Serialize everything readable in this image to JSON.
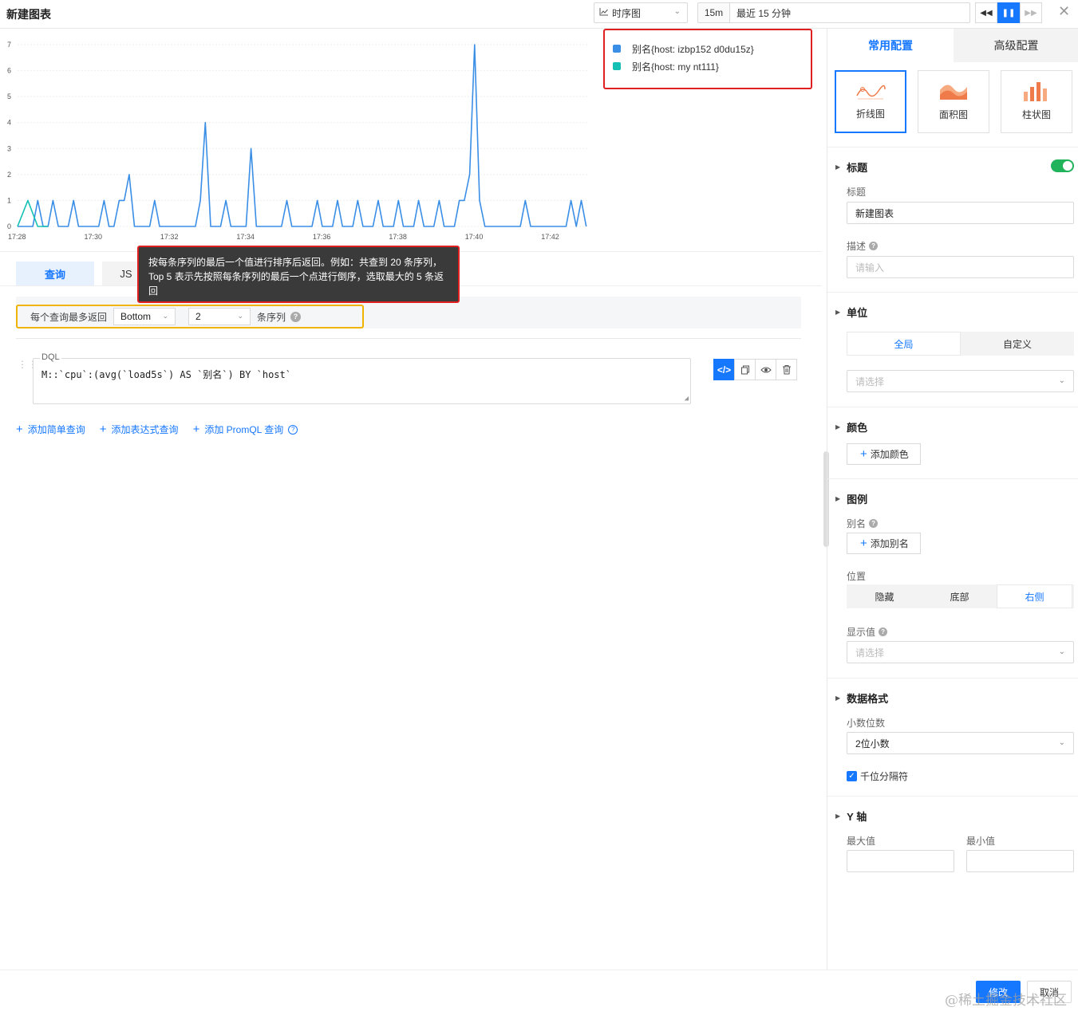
{
  "header": {
    "title": "新建图表",
    "chart_type": "时序图",
    "time_short": "15m",
    "time_label": "最近 15 分钟",
    "rewind_icon": "rewind-icon",
    "pause_icon": "pause-icon",
    "forward_icon": "fast-forward-icon",
    "close_icon": "close-icon"
  },
  "chart_data": {
    "type": "line",
    "x_tick_labels": [
      "17:28",
      "17:30",
      "17:32",
      "17:34",
      "17:36",
      "17:38",
      "17:40",
      "17:42"
    ],
    "y_tick_labels": [
      "0",
      "1",
      "2",
      "3",
      "4",
      "5",
      "6",
      "7"
    ],
    "ylim": [
      0,
      7
    ],
    "xlim_minutes_from_1728": [
      0,
      15
    ],
    "grid": true,
    "legend_position": "right",
    "series": [
      {
        "name": "别名{host: izbp152          d0du15z}",
        "color": "#3a8ee6",
        "x": [
          0,
          0.2,
          0.4,
          0.53,
          0.67,
          0.8,
          0.93,
          1.07,
          1.2,
          1.33,
          1.47,
          1.6,
          1.73,
          1.87,
          2,
          2.13,
          2.27,
          2.4,
          2.53,
          2.67,
          2.8,
          2.93,
          3.07,
          3.2,
          3.33,
          3.47,
          3.6,
          3.73,
          3.87,
          4,
          4.13,
          4.27,
          4.4,
          4.53,
          4.67,
          4.8,
          4.93,
          5.07,
          5.2,
          5.33,
          5.47,
          5.6,
          5.73,
          5.87,
          6,
          6.13,
          6.27,
          6.4,
          6.53,
          6.67,
          6.8,
          6.93,
          7.07,
          7.2,
          7.33,
          7.47,
          7.6,
          7.73,
          7.87,
          8,
          8.13,
          8.27,
          8.4,
          8.53,
          8.67,
          8.8,
          8.93,
          9.07,
          9.2,
          9.33,
          9.47,
          9.6,
          9.73,
          9.87,
          10,
          10.13,
          10.27,
          10.4,
          10.53,
          10.67,
          10.8,
          10.93,
          11.07,
          11.2,
          11.33,
          11.47,
          11.6,
          11.73,
          11.87,
          12,
          12.13,
          12.27,
          12.4,
          12.53,
          12.67,
          12.8,
          12.93,
          13.07,
          13.2,
          13.33,
          13.47,
          13.6,
          13.73,
          13.87,
          14,
          14.13,
          14.27,
          14.4,
          14.53,
          14.67,
          14.8,
          14.93
        ],
        "values": [
          0,
          0,
          0,
          1,
          0,
          0,
          1,
          0,
          0,
          0,
          1,
          0,
          0,
          0,
          0,
          0,
          1,
          0,
          0,
          1,
          1,
          2,
          0,
          0,
          0,
          0,
          1,
          0,
          0,
          0,
          0,
          0,
          0,
          0,
          0,
          1,
          4,
          0,
          0,
          0,
          1,
          0,
          0,
          0,
          0,
          3,
          0,
          0,
          0,
          0,
          0,
          0,
          1,
          0,
          0,
          0,
          0,
          0,
          1,
          0,
          0,
          0,
          1,
          0,
          0,
          0,
          1,
          0,
          0,
          0,
          1,
          0,
          0,
          0,
          1,
          0,
          0,
          0,
          1,
          0,
          0,
          0,
          1,
          0,
          0,
          0,
          1,
          1,
          2,
          7,
          1,
          0,
          0,
          0,
          0,
          0,
          0,
          0,
          0,
          1,
          0,
          0,
          0,
          0,
          0,
          0,
          0,
          0,
          1,
          0,
          1,
          0
        ],
        "type": "line"
      },
      {
        "name": "别名{host: my        nt111}",
        "color": "#14c0b4",
        "x": [
          0,
          0.27,
          0.53,
          0.8
        ],
        "values": [
          0,
          1,
          0,
          0
        ],
        "type": "line"
      }
    ]
  },
  "query": {
    "tabs": [
      "查询",
      "JS"
    ],
    "tooltip_line1": "按每条序列的最后一个值进行排序后返回。例如：共查到 20 条序列，",
    "tooltip_line2": "Top 5 表示先按照每条序列的最后一个点进行倒序，选取最大的 5 条返",
    "tooltip_line3": "回",
    "limit_label": "每个查询最多返回",
    "limit_order": "Bottom",
    "limit_count": "2",
    "limit_suffix": "条序列",
    "dql_label": "DQL",
    "dql_text": "M::`cpu`:(avg(`load5s`) AS `别名`) BY `host`",
    "add_simple": "添加简单查询",
    "add_expression": "添加表达式查询",
    "add_promql": "添加 PromQL 查询"
  },
  "panel": {
    "tab_common": "常用配置",
    "tab_advanced": "高级配置",
    "vis_types": [
      "折线图",
      "面积图",
      "柱状图"
    ],
    "title_section": "标题",
    "title_label": "标题",
    "title_value": "新建图表",
    "desc_label": "描述",
    "desc_placeholder": "请输入",
    "unit_section": "单位",
    "unit_global": "全局",
    "unit_custom": "自定义",
    "unit_placeholder": "请选择",
    "color_section": "颜色",
    "add_color": "添加颜色",
    "legend_section": "图例",
    "alias_label": "别名",
    "add_alias": "添加别名",
    "position_label": "位置",
    "position_options": [
      "隐藏",
      "底部",
      "右侧"
    ],
    "position_selected": "右侧",
    "display_value_label": "显示值",
    "display_value_placeholder": "请选择",
    "format_section": "数据格式",
    "decimal_label": "小数位数",
    "decimal_value": "2位小数",
    "thousand_sep": "千位分隔符",
    "yaxis_section": "Y 轴",
    "ymax_label": "最大值",
    "ymin_label": "最小值"
  },
  "footer": {
    "submit": "修改",
    "cancel": "取消",
    "watermark": "@稀土掘金技术社区"
  }
}
